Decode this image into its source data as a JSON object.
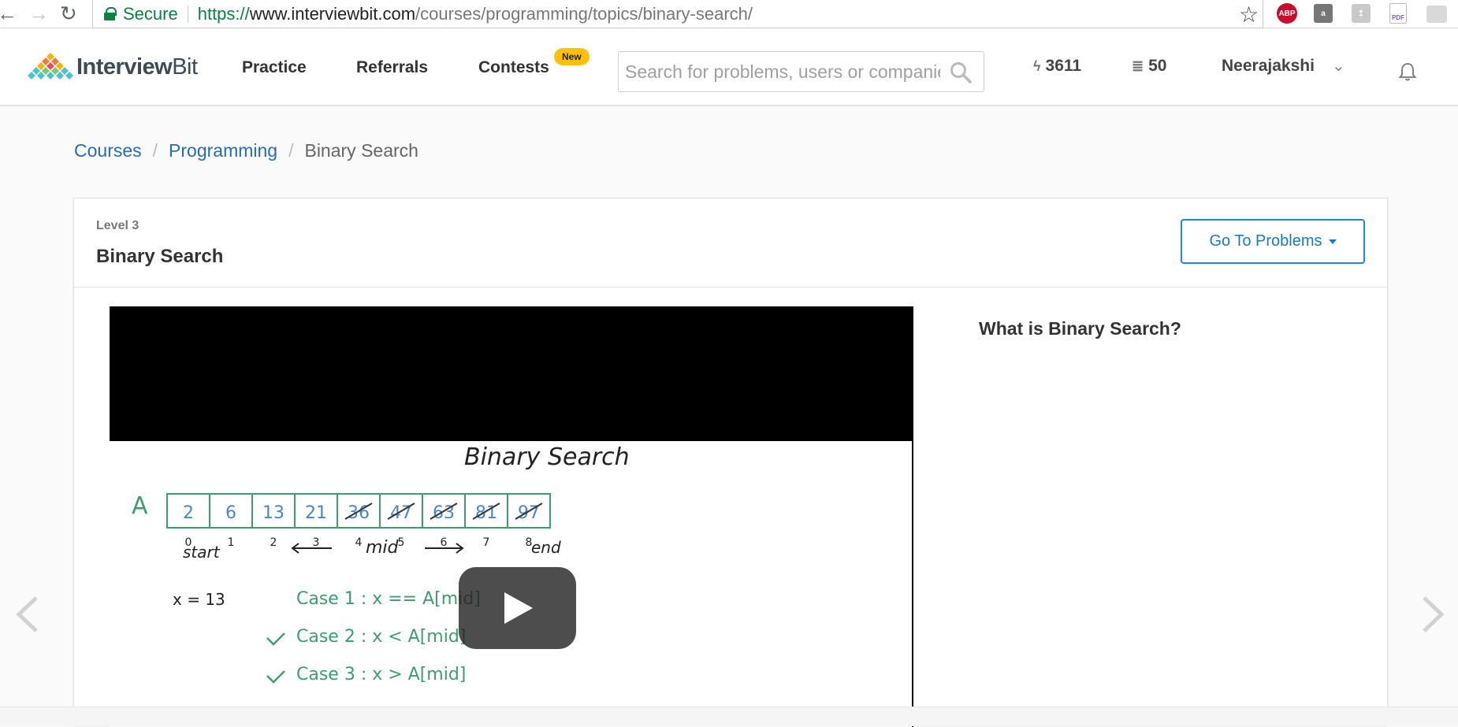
{
  "browser": {
    "secure_label": "Secure",
    "url_proto": "https://",
    "url_host": "www.interviewbit.com",
    "url_path": "/courses/programming/topics/binary-search/",
    "ext_abp": "ABP",
    "ext_pdf": "PDF"
  },
  "header": {
    "logo_main": "Interview",
    "logo_bit": "Bit",
    "nav": {
      "practice": "Practice",
      "referrals": "Referrals",
      "contests": "Contests"
    },
    "new_badge": "New",
    "search_placeholder": "Search for problems, users or companies",
    "stat_bolt": "3611",
    "stat_coins": "50",
    "user_name": "Neerajakshi"
  },
  "breadcrumb": {
    "courses": "Courses",
    "programming": "Programming",
    "current": "Binary Search",
    "separator": "/"
  },
  "topic": {
    "level": "Level 3",
    "title": "Binary Search",
    "goto_label": "Go To Problems",
    "question": "What is Binary Search?"
  },
  "video": {
    "board_title": "Binary Search",
    "array_name": "A",
    "cells": [
      "2",
      "6",
      "13",
      "21",
      "36",
      "47",
      "63",
      "81",
      "97"
    ],
    "indices": [
      "0",
      "1",
      "2",
      "3",
      "4",
      "5",
      "6",
      "7",
      "8"
    ],
    "start_label": "start",
    "mid_label": "mid",
    "end_label": "end",
    "x_eq": "x = 13",
    "case1": "Case 1 :   x == A[mid]",
    "case2": "Case 2 :   x < A[mid]",
    "case3": "Case 3 :   x > A[mid]"
  },
  "colors": {
    "accent_blue": "#1a8ad4",
    "link_blue": "#2a6bb3",
    "secure_green": "#0b8043",
    "badge_yellow": "#ffc107",
    "marker_green": "#3e9d6e"
  }
}
